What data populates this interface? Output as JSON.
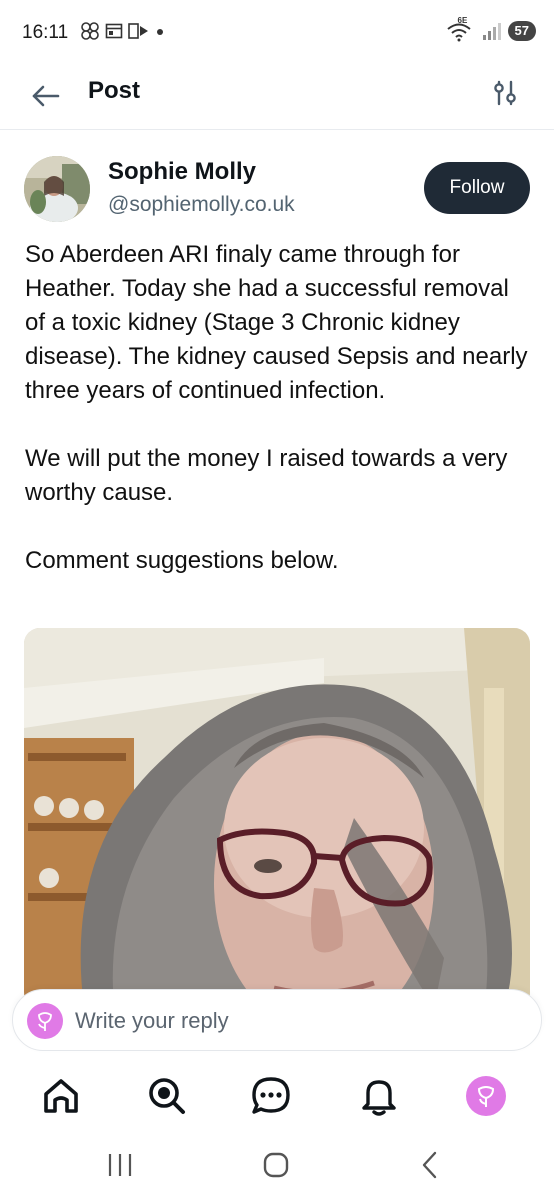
{
  "status_bar": {
    "time": "16:11",
    "network_label": "6E",
    "battery": "57"
  },
  "header": {
    "title": "Post",
    "back_icon": "arrow-left-icon",
    "filter_icon": "sliders-icon"
  },
  "post": {
    "author_name": "Sophie Molly",
    "author_handle": "@sophiemolly.co.uk",
    "follow_label": "Follow",
    "paragraphs": [
      "So Aberdeen ARI finaly came through for Heather. Today she had a successful removal of a toxic kidney (Stage 3 Chronic kidney disease). The kidney caused Sepsis and nearly three years of continued infection.",
      "We will put the money I raised towards a very worthy cause.",
      "Comment suggestions below."
    ]
  },
  "reply": {
    "placeholder": "Write your reply"
  },
  "bottom_nav": {
    "items": [
      "home-icon",
      "search-icon",
      "chat-icon",
      "bell-icon",
      "profile-avatar"
    ]
  },
  "system_nav": {
    "items": [
      "recents-icon",
      "home-circle-icon",
      "back-chevron-icon"
    ]
  },
  "colors": {
    "follow_bg": "#1f2a36",
    "handle": "#536471",
    "avatar_pink": "#e07ae6"
  }
}
